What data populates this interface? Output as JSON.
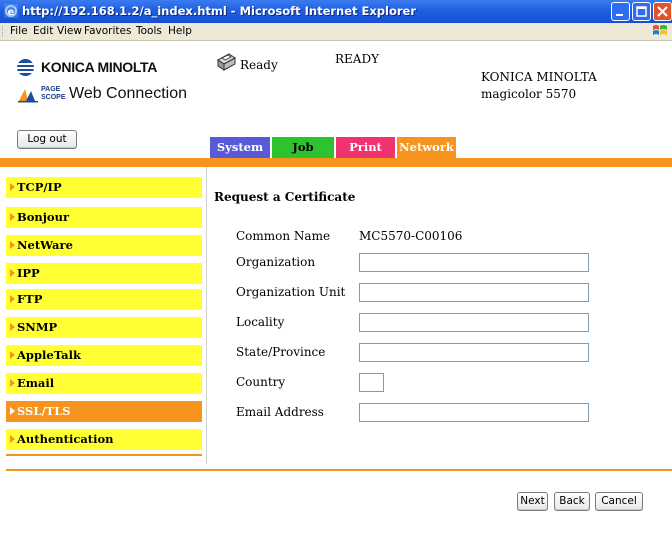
{
  "window": {
    "title": "http://192.168.1.2/a_index.html - Microsoft Internet Explorer",
    "icons": [
      "ie-icon",
      "minimize-icon",
      "maximize-icon",
      "close-icon",
      "windows-logo-icon"
    ]
  },
  "menubar": {
    "items": [
      "File",
      "Edit",
      "View",
      "Favorites",
      "Tools",
      "Help"
    ]
  },
  "header": {
    "brand": "KONICA MINOLTA",
    "pagescope_text": "PAGE SCOPE",
    "web_connection": "Web Connection",
    "status_icon_text": "Ready",
    "status_text": "READY",
    "model_maker": "KONICA MINOLTA",
    "model_name": "magicolor 5570",
    "logout_label": "Log out"
  },
  "tabs": [
    {
      "label": "System",
      "color": "#5a5ad8"
    },
    {
      "label": "Job",
      "color": "#2ec22e"
    },
    {
      "label": "Print",
      "color": "#f0336f"
    },
    {
      "label": "Network",
      "color": "#f7941d",
      "active": true
    }
  ],
  "sidebar": {
    "items": [
      {
        "label": "TCP/IP"
      },
      {
        "label": "Bonjour"
      },
      {
        "label": "NetWare"
      },
      {
        "label": "IPP"
      },
      {
        "label": "FTP"
      },
      {
        "label": "SNMP"
      },
      {
        "label": "AppleTalk"
      },
      {
        "label": "Email"
      },
      {
        "label": "SSL/TLS",
        "active": true
      },
      {
        "label": "Authentication"
      }
    ]
  },
  "form": {
    "title": "Request a Certificate",
    "common_name_label": "Common Name",
    "common_name_value": "MC5570-C00106",
    "organization_label": "Organization",
    "organization_value": "",
    "org_unit_label": "Organization Unit",
    "org_unit_value": "",
    "locality_label": "Locality",
    "locality_value": "",
    "state_label": "State/Province",
    "state_value": "",
    "country_label": "Country",
    "country_value": "",
    "email_label": "Email Address",
    "email_value": ""
  },
  "footer": {
    "next_label": "Next",
    "back_label": "Back",
    "cancel_label": "Cancel"
  },
  "colors": {
    "accent_orange": "#f7941d",
    "nav_yellow": "#ffff33",
    "titlebar_blue": "#1f5fe0"
  }
}
